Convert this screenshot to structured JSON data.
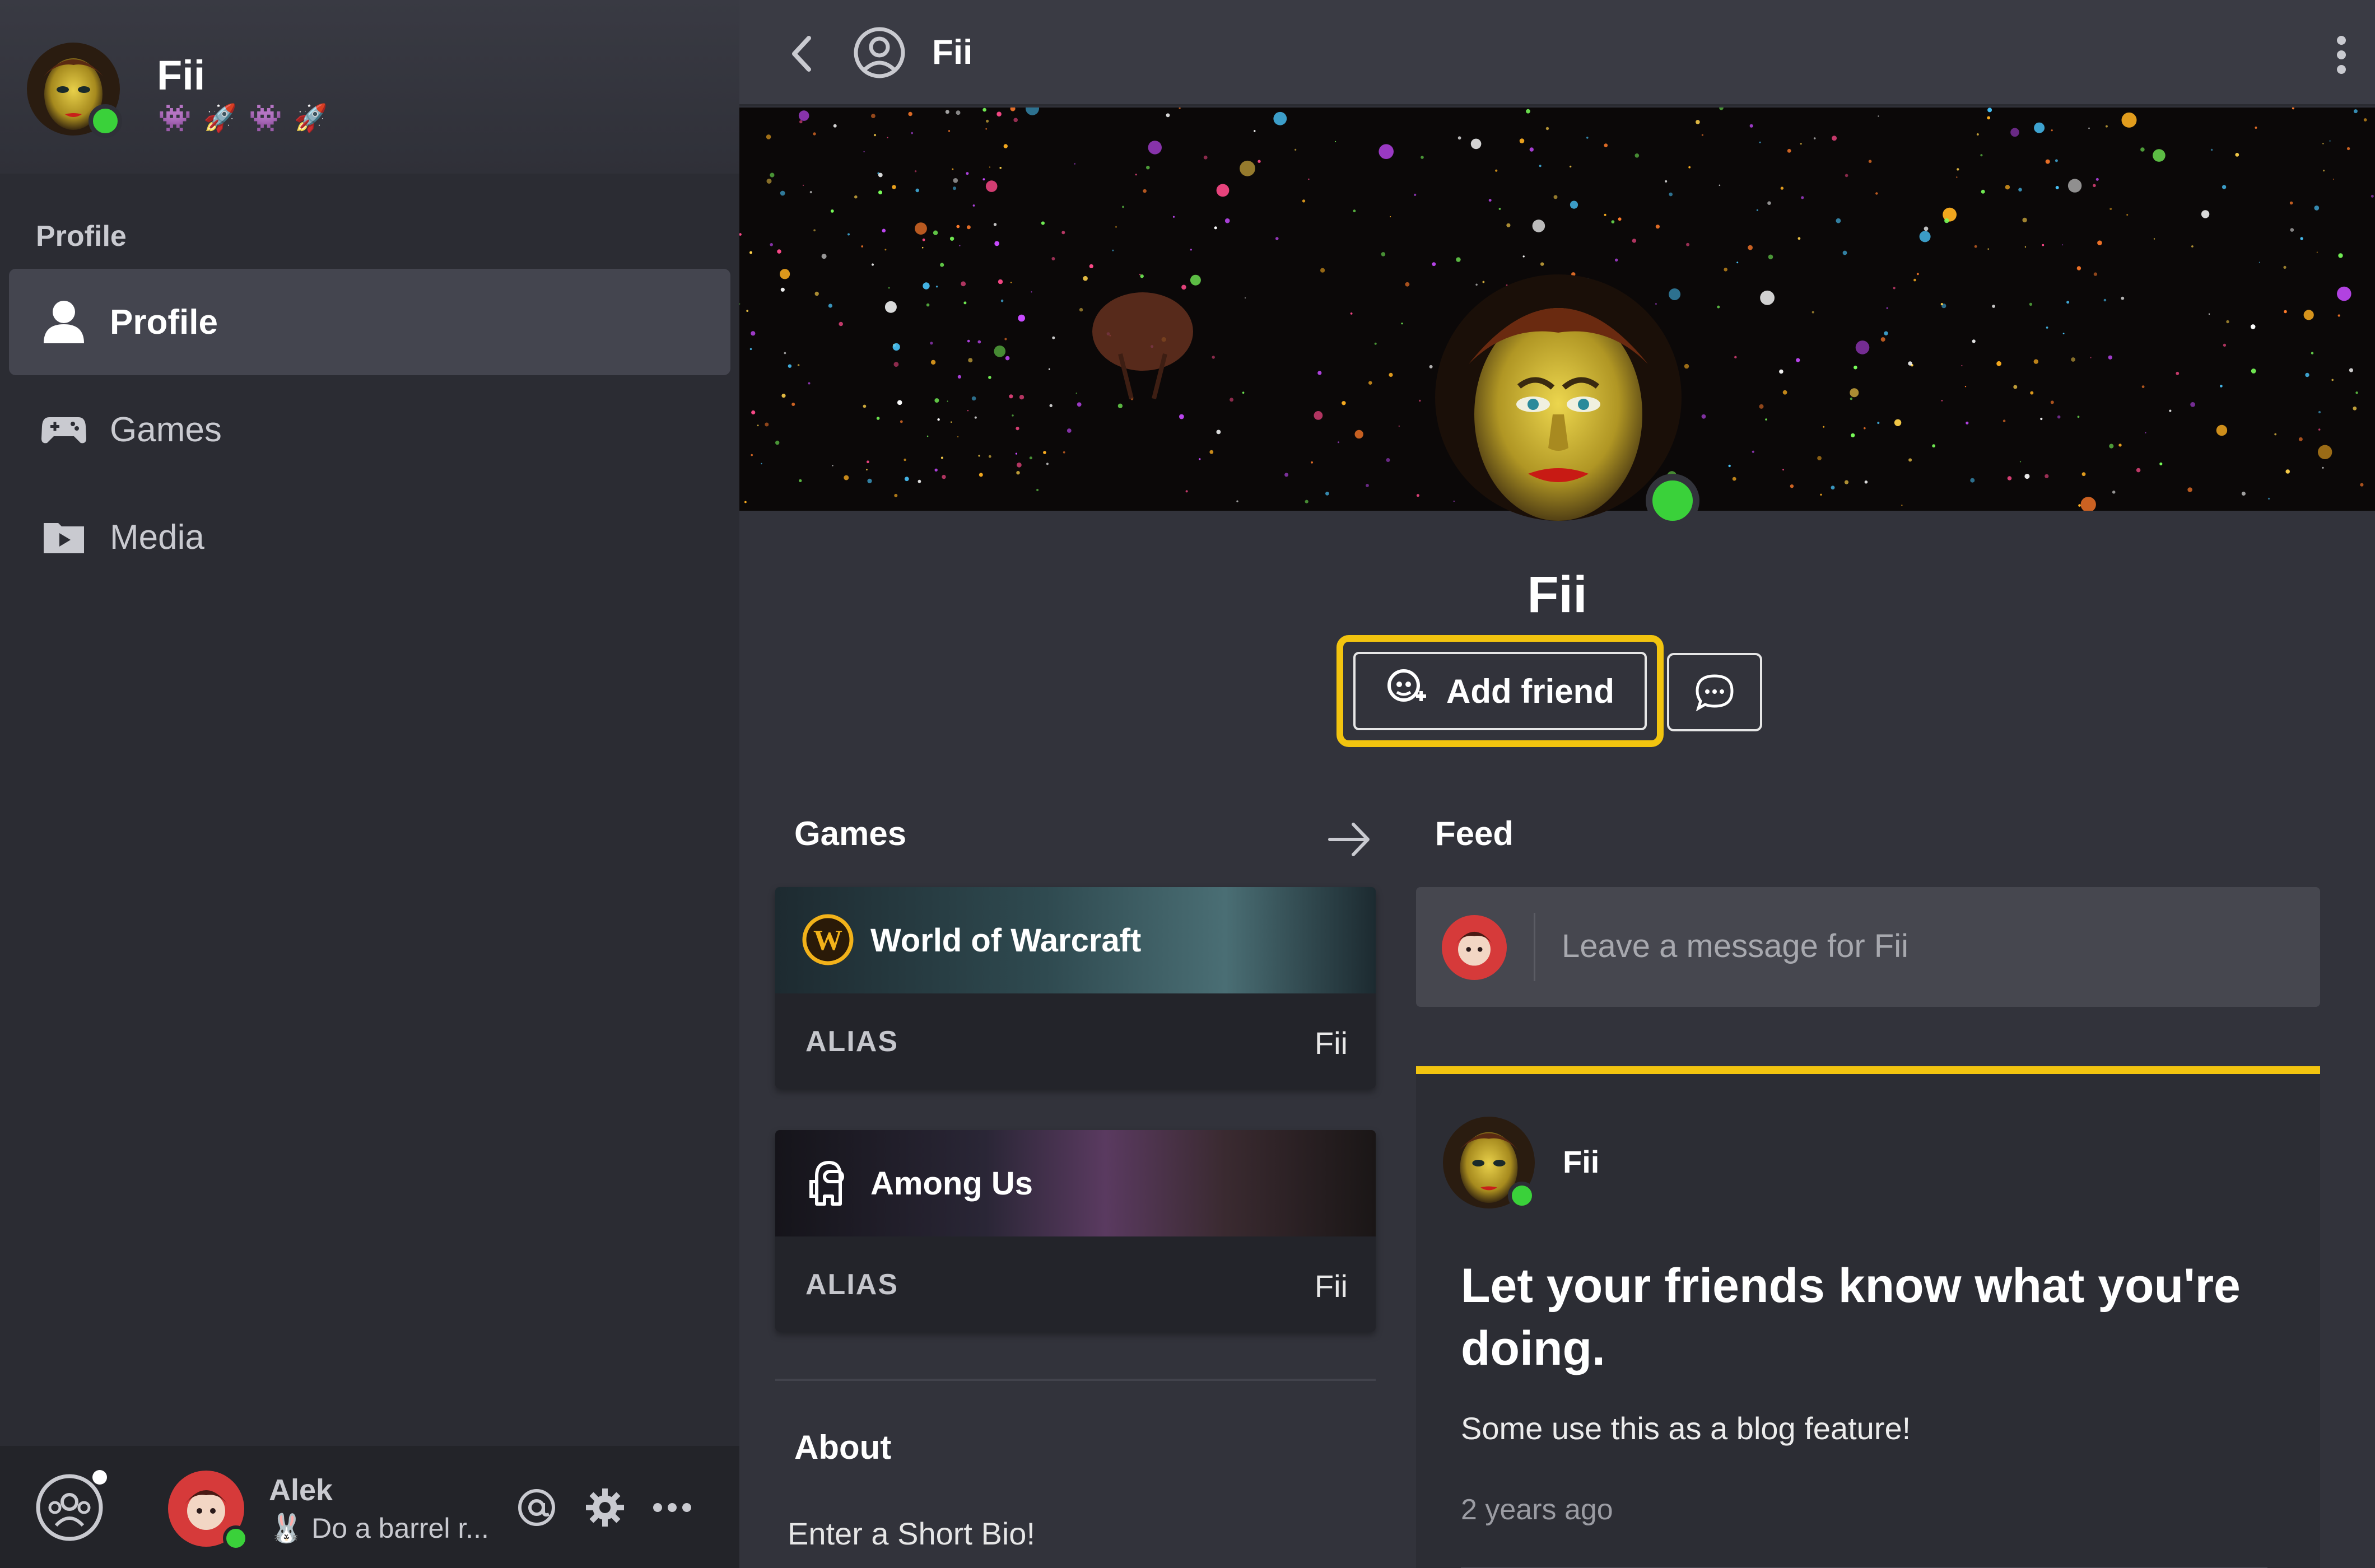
{
  "sidebar": {
    "user": {
      "name": "Fii",
      "status_icons": "👾 🚀 👾 🚀"
    },
    "section_label": "Profile",
    "items": [
      {
        "label": "Profile",
        "icon": "person-icon",
        "active": true
      },
      {
        "label": "Games",
        "icon": "gamepad-icon",
        "active": false
      },
      {
        "label": "Media",
        "icon": "media-folder-icon",
        "active": false
      }
    ],
    "footer": {
      "name": "Alek",
      "status": "🐰 Do a barrel r..."
    }
  },
  "topbar": {
    "title": "Fii"
  },
  "profile": {
    "name": "Fii"
  },
  "actions": {
    "add_friend": "Add friend"
  },
  "games": {
    "title": "Games",
    "list": [
      {
        "title": "World of Warcraft",
        "alias_label": "ALIAS",
        "alias": "Fii"
      },
      {
        "title": "Among Us",
        "alias_label": "ALIAS",
        "alias": "Fii"
      }
    ]
  },
  "about": {
    "title": "About",
    "bio": "Enter a Short Bio!"
  },
  "feed": {
    "title": "Feed",
    "placeholder": "Leave a message for Fii",
    "post": {
      "author": "Fii",
      "title": "Let your friends know what you're doing.",
      "body": "Some use this as a blog feature!",
      "time": "2 years ago"
    }
  },
  "colors": {
    "accent": "#f2c40f",
    "online": "#3ad13a",
    "background": "#32333b",
    "sidebar": "#2b2c33"
  }
}
